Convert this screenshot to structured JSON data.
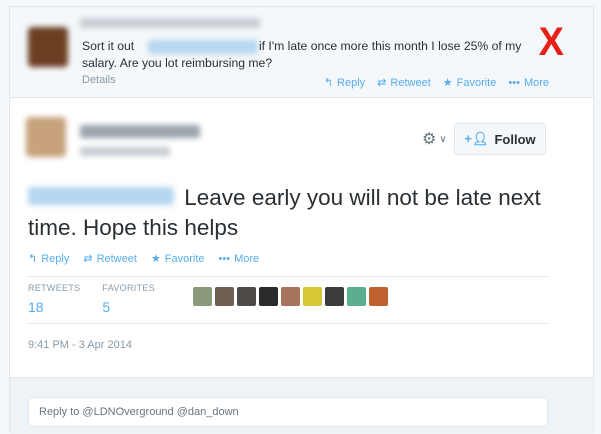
{
  "parent_tweet": {
    "text_start": "Sort it out",
    "text_rest": "if I'm late once more this month I lose 25% of my salary. Are you lot reimbursing me?",
    "details": "Details",
    "actions": {
      "reply": "Reply",
      "retweet": "Retweet",
      "favorite": "Favorite",
      "more": "More"
    }
  },
  "overlay": {
    "mark": "X",
    "color": "#e62117"
  },
  "main_tweet": {
    "text": "Leave early you will not be late next time. Hope this helps",
    "follow_label": "Follow",
    "actions": {
      "reply": "Reply",
      "retweet": "Retweet",
      "favorite": "Favorite",
      "more": "More"
    },
    "stats": {
      "retweets_label": "RETWEETS",
      "retweets_count": "18",
      "favorites_label": "FAVORITES",
      "favorites_count": "5"
    },
    "timestamp": "9:41 PM - 3 Apr 2014"
  },
  "reply_box": {
    "placeholder": "Reply to @LDNOverground @dan_down"
  },
  "colors": {
    "accent": "#55acee",
    "text": "#292f33",
    "muted": "#8899a6",
    "background": "#f5f8fa"
  },
  "favoriter_avatar_colors": [
    "#8a9a7b",
    "#6e5f55",
    "#4d4a48",
    "#2a2a2a",
    "#a8745e",
    "#d9c634",
    "#3b3b3b",
    "#5cae8e",
    "#c0622f"
  ]
}
